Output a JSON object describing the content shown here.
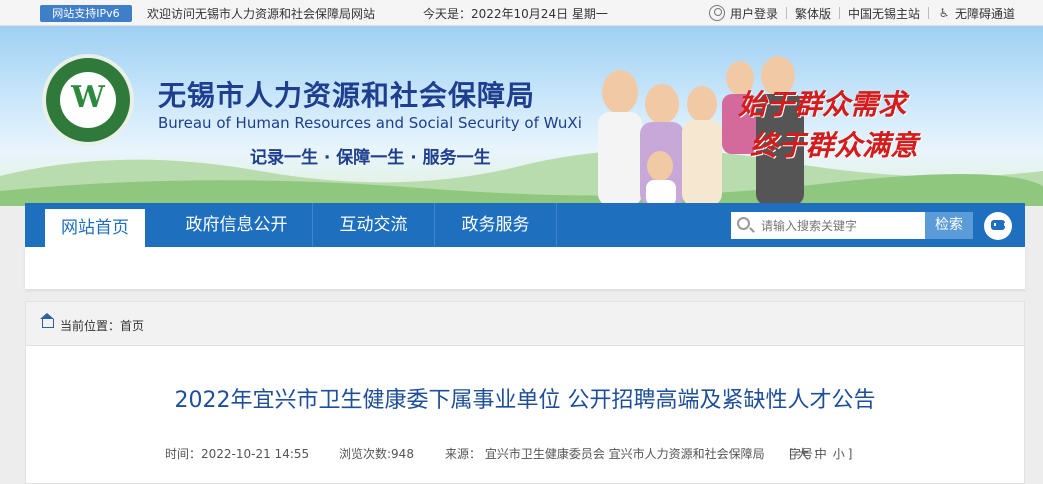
{
  "topbar": {
    "ipv6_badge": "网站支持IPv6",
    "welcome": "欢迎访问无锡市人力资源和社会保障局网站",
    "today": "今天是：2022年10月24日 星期一",
    "links": {
      "login": "用户登录",
      "traditional": "繁体版",
      "wuxi_main": "中国无锡主站",
      "accessibility": "无障碍通道"
    }
  },
  "banner": {
    "org_name_cn": "无锡市人力资源和社会保障局",
    "org_name_en": "Bureau of Human Resources and Social Security of WuXi",
    "slogan": "记录一生 · 保障一生 · 服务一生",
    "motto_line1": "始于群众需求",
    "motto_line2": "终于群众满意",
    "logo_letter": "W"
  },
  "nav": {
    "items": [
      {
        "label": "网站首页"
      },
      {
        "label": "政府信息公开"
      },
      {
        "label": "互动交流"
      },
      {
        "label": "政务服务"
      }
    ],
    "search_placeholder": "请输入搜索关键字",
    "search_button": "检索"
  },
  "breadcrumb": {
    "label": "当前位置：",
    "home": "首页"
  },
  "article": {
    "title": "2022年宜兴市卫生健康委下属事业单位 公开招聘高端及紧缺性人才公告",
    "time": "时间：2022-10-21 14:55",
    "views": "浏览次数:948",
    "source": "来源：  宜兴市卫生健康委员会 宜兴市人力资源和社会保障局",
    "font_size_label": "字号：",
    "font_sizes": [
      "大",
      "中",
      "小"
    ]
  },
  "colors": {
    "nav_blue": "#1f6fbf",
    "title_blue": "#1f4f99",
    "motto_red": "#d41c1c",
    "logo_green": "#2f7a3a"
  }
}
